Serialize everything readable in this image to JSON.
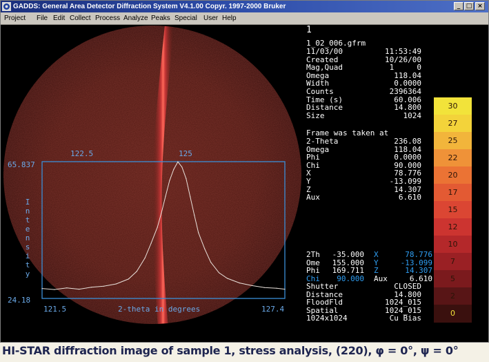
{
  "window": {
    "title": "GADDS: General Area Detector Diffraction System V4.1.00  Copyr. 1997-2000 Bruker",
    "buttons": [
      "_",
      "□",
      "×"
    ]
  },
  "menu": [
    "Project",
    "File",
    "Edit",
    "Collect",
    "Process",
    "Analyze",
    "Peaks",
    "Special",
    "User",
    "Help"
  ],
  "plot": {
    "ymax": "65.837",
    "ymin": "24.18",
    "xmin": "121.5",
    "xmax": "127.4",
    "top_tick1": "122.5",
    "top_tick2": "125",
    "xlabel": "2-theta in degrees",
    "ylabel": "Intensity"
  },
  "chart_data": {
    "type": "line",
    "title": "",
    "xlabel": "2-theta in degrees",
    "ylabel": "Intensity",
    "xlim": [
      121.5,
      127.4
    ],
    "ylim": [
      24.18,
      65.837
    ],
    "x": [
      121.5,
      121.8,
      122.1,
      122.4,
      122.7,
      123.0,
      123.3,
      123.6,
      123.8,
      124.0,
      124.15,
      124.3,
      124.4,
      124.5,
      124.6,
      124.7,
      124.8,
      124.9,
      125.0,
      125.1,
      125.2,
      125.3,
      125.45,
      125.6,
      125.8,
      126.0,
      126.3,
      126.6,
      126.9,
      127.2,
      127.4
    ],
    "y": [
      27.2,
      26.9,
      27.4,
      27.0,
      27.6,
      27.9,
      28.6,
      30.1,
      32.4,
      36.5,
      41.0,
      45.8,
      50.2,
      55.3,
      60.1,
      63.5,
      65.8,
      64.2,
      60.7,
      55.1,
      49.6,
      44.2,
      39.3,
      35.2,
      32.0,
      30.3,
      28.9,
      28.1,
      27.5,
      27.3,
      27.0
    ]
  },
  "info": {
    "frame_no": "1",
    "filename": "1_02_006.gfrm",
    "rows1": [
      [
        "11/03/00",
        "11:53:49"
      ],
      [
        "Created",
        "10/26/00"
      ],
      [
        "Mag,Quad",
        "1     0"
      ],
      [
        "Omega",
        "118.04"
      ],
      [
        "Width",
        "0.0000"
      ],
      [
        "Counts",
        "2396364"
      ],
      [
        "Time (s)",
        "60.006"
      ],
      [
        "Distance",
        "14.800"
      ],
      [
        "Size",
        "1024"
      ]
    ],
    "frame_header": "Frame was taken at",
    "rows2": [
      [
        "2-Theta",
        "236.08"
      ],
      [
        "Omega",
        "118.04"
      ],
      [
        "Phi",
        "0.0000"
      ],
      [
        "Chi",
        "90.000"
      ],
      [
        "X",
        "78.776"
      ],
      [
        "Y",
        "-13.099"
      ],
      [
        "Z",
        "14.307"
      ],
      [
        "Aux",
        "6.610"
      ]
    ],
    "cursor": [
      [
        "2Th",
        "-35.000",
        "X",
        "78.776"
      ],
      [
        "Ome",
        "155.000",
        "Y",
        "-13.099"
      ],
      [
        "Phi",
        "169.711",
        "Z",
        "14.307"
      ],
      [
        "Chi",
        "90.000",
        "Aux",
        "6.610"
      ]
    ],
    "rows3": [
      [
        "Shutter",
        "CLOSED"
      ],
      [
        "Distance",
        "14.800"
      ],
      [
        "FloodFld",
        "1024_015"
      ],
      [
        "Spatial",
        "1024_015"
      ],
      [
        "1024x1024",
        "Cu Bias"
      ]
    ]
  },
  "colorscale": {
    "labels": [
      "30",
      "27",
      "25",
      "22",
      "20",
      "17",
      "15",
      "12",
      "10",
      "7",
      "5",
      "2",
      "0"
    ],
    "colors": [
      "#f2e33a",
      "#f3d33a",
      "#f2b53b",
      "#ef9238",
      "#eb7334",
      "#e35a33",
      "#db4633",
      "#cc3430",
      "#b4282a",
      "#9a2024",
      "#7b1a1d",
      "#581516",
      "#3a100e"
    ]
  },
  "caption": "HI-STAR diffraction image of sample 1, stress analysis, (220), φ = 0°, ψ = 0°"
}
